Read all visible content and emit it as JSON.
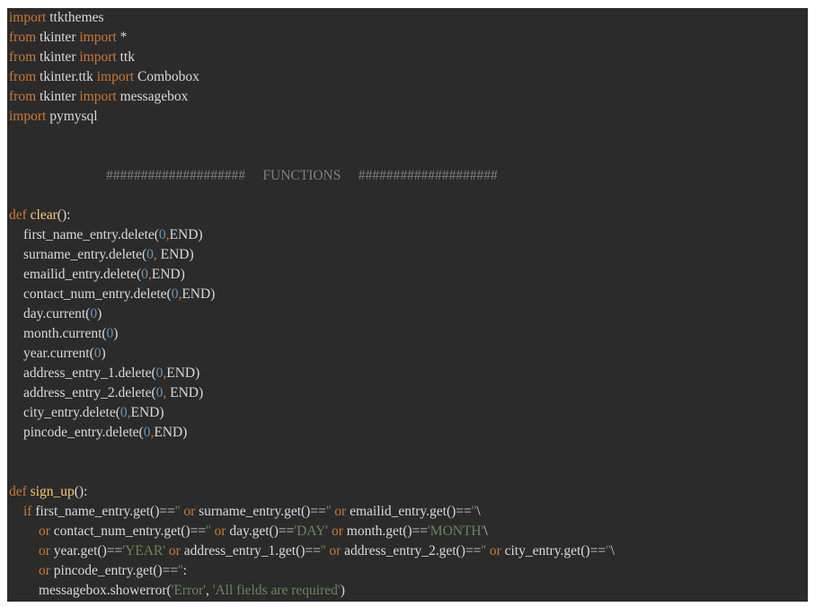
{
  "colors": {
    "background": "#2b2b2b",
    "keyword": "#cc7832",
    "function_name": "#ffc66d",
    "number": "#6897bb",
    "string": "#6a8759",
    "comment": "#808080",
    "text": "#d9d9d9"
  },
  "code_lines": [
    {
      "indent": 0,
      "tokens": [
        {
          "t": "kw",
          "v": "import"
        },
        {
          "t": "tx",
          "v": " ttkthemes"
        }
      ]
    },
    {
      "indent": 0,
      "tokens": [
        {
          "t": "kw",
          "v": "from"
        },
        {
          "t": "tx",
          "v": " tkinter "
        },
        {
          "t": "kw",
          "v": "import"
        },
        {
          "t": "tx",
          "v": " *"
        }
      ]
    },
    {
      "indent": 0,
      "tokens": [
        {
          "t": "kw",
          "v": "from"
        },
        {
          "t": "tx",
          "v": " tkinter "
        },
        {
          "t": "kw",
          "v": "import"
        },
        {
          "t": "tx",
          "v": " ttk"
        }
      ]
    },
    {
      "indent": 0,
      "tokens": [
        {
          "t": "kw",
          "v": "from"
        },
        {
          "t": "tx",
          "v": " tkinter.ttk "
        },
        {
          "t": "kw",
          "v": "import"
        },
        {
          "t": "tx",
          "v": " Combobox"
        }
      ]
    },
    {
      "indent": 0,
      "tokens": [
        {
          "t": "kw",
          "v": "from"
        },
        {
          "t": "tx",
          "v": " tkinter "
        },
        {
          "t": "kw",
          "v": "import"
        },
        {
          "t": "tx",
          "v": " messagebox"
        }
      ]
    },
    {
      "indent": 0,
      "tokens": [
        {
          "t": "kw",
          "v": "import"
        },
        {
          "t": "tx",
          "v": " pymysql"
        }
      ]
    },
    {
      "indent": 0,
      "tokens": []
    },
    {
      "indent": 0,
      "tokens": []
    },
    {
      "indent": 108,
      "tokens": [
        {
          "t": "cm",
          "v": "####################     FUNCTIONS     ####################"
        }
      ]
    },
    {
      "indent": 0,
      "tokens": []
    },
    {
      "indent": 0,
      "tokens": [
        {
          "t": "kw",
          "v": "def"
        },
        {
          "t": "tx",
          "v": " "
        },
        {
          "t": "fn",
          "v": "clear"
        },
        {
          "t": "tx",
          "v": "():"
        }
      ]
    },
    {
      "indent": 16,
      "tokens": [
        {
          "t": "tx",
          "v": "first_name_entry.delete("
        },
        {
          "t": "num",
          "v": "0"
        },
        {
          "t": "kw",
          "v": ","
        },
        {
          "t": "tx",
          "v": "END)"
        }
      ]
    },
    {
      "indent": 16,
      "tokens": [
        {
          "t": "tx",
          "v": "surname_entry.delete("
        },
        {
          "t": "num",
          "v": "0"
        },
        {
          "t": "kw",
          "v": ","
        },
        {
          "t": "tx",
          "v": " END)"
        }
      ]
    },
    {
      "indent": 16,
      "tokens": [
        {
          "t": "tx",
          "v": "emailid_entry.delete("
        },
        {
          "t": "num",
          "v": "0"
        },
        {
          "t": "kw",
          "v": ","
        },
        {
          "t": "tx",
          "v": "END)"
        }
      ]
    },
    {
      "indent": 16,
      "tokens": [
        {
          "t": "tx",
          "v": "contact_num_entry.delete("
        },
        {
          "t": "num",
          "v": "0"
        },
        {
          "t": "kw",
          "v": ","
        },
        {
          "t": "tx",
          "v": "END)"
        }
      ]
    },
    {
      "indent": 16,
      "tokens": [
        {
          "t": "tx",
          "v": "day.current("
        },
        {
          "t": "num",
          "v": "0"
        },
        {
          "t": "tx",
          "v": ")"
        }
      ]
    },
    {
      "indent": 16,
      "tokens": [
        {
          "t": "tx",
          "v": "month.current("
        },
        {
          "t": "num",
          "v": "0"
        },
        {
          "t": "tx",
          "v": ")"
        }
      ]
    },
    {
      "indent": 16,
      "tokens": [
        {
          "t": "tx",
          "v": "year.current("
        },
        {
          "t": "num",
          "v": "0"
        },
        {
          "t": "tx",
          "v": ")"
        }
      ]
    },
    {
      "indent": 16,
      "tokens": [
        {
          "t": "tx",
          "v": "address_entry_1.delete("
        },
        {
          "t": "num",
          "v": "0"
        },
        {
          "t": "kw",
          "v": ","
        },
        {
          "t": "tx",
          "v": "END)"
        }
      ]
    },
    {
      "indent": 16,
      "tokens": [
        {
          "t": "tx",
          "v": "address_entry_2.delete("
        },
        {
          "t": "num",
          "v": "0"
        },
        {
          "t": "kw",
          "v": ","
        },
        {
          "t": "tx",
          "v": " END)"
        }
      ]
    },
    {
      "indent": 16,
      "tokens": [
        {
          "t": "tx",
          "v": "city_entry.delete("
        },
        {
          "t": "num",
          "v": "0"
        },
        {
          "t": "kw",
          "v": ","
        },
        {
          "t": "tx",
          "v": "END)"
        }
      ]
    },
    {
      "indent": 16,
      "tokens": [
        {
          "t": "tx",
          "v": "pincode_entry.delete("
        },
        {
          "t": "num",
          "v": "0"
        },
        {
          "t": "kw",
          "v": ","
        },
        {
          "t": "tx",
          "v": "END)"
        }
      ]
    },
    {
      "indent": 0,
      "tokens": []
    },
    {
      "indent": 0,
      "tokens": []
    },
    {
      "indent": 0,
      "tokens": [
        {
          "t": "kw",
          "v": "def"
        },
        {
          "t": "tx",
          "v": " "
        },
        {
          "t": "fn",
          "v": "sign_up"
        },
        {
          "t": "tx",
          "v": "():"
        }
      ]
    },
    {
      "indent": 16,
      "tokens": [
        {
          "t": "kw",
          "v": "if"
        },
        {
          "t": "tx",
          "v": " first_name_entry.get()=="
        },
        {
          "t": "str",
          "v": "''"
        },
        {
          "t": "tx",
          "v": " "
        },
        {
          "t": "kw",
          "v": "or"
        },
        {
          "t": "tx",
          "v": " surname_entry.get()=="
        },
        {
          "t": "str",
          "v": "''"
        },
        {
          "t": "tx",
          "v": " "
        },
        {
          "t": "kw",
          "v": "or"
        },
        {
          "t": "tx",
          "v": " emailid_entry.get()=="
        },
        {
          "t": "str",
          "v": "''"
        },
        {
          "t": "tx",
          "v": "\\"
        }
      ]
    },
    {
      "indent": 33,
      "tokens": [
        {
          "t": "kw",
          "v": "or"
        },
        {
          "t": "tx",
          "v": " contact_num_entry.get()=="
        },
        {
          "t": "str",
          "v": "''"
        },
        {
          "t": "tx",
          "v": " "
        },
        {
          "t": "kw",
          "v": "or"
        },
        {
          "t": "tx",
          "v": " day.get()=="
        },
        {
          "t": "str",
          "v": "'DAY'"
        },
        {
          "t": "tx",
          "v": " "
        },
        {
          "t": "kw",
          "v": "or"
        },
        {
          "t": "tx",
          "v": " month.get()=="
        },
        {
          "t": "str",
          "v": "'MONTH'"
        },
        {
          "t": "tx",
          "v": "\\"
        }
      ]
    },
    {
      "indent": 33,
      "tokens": [
        {
          "t": "kw",
          "v": "or"
        },
        {
          "t": "tx",
          "v": " year.get()=="
        },
        {
          "t": "str",
          "v": "'YEAR'"
        },
        {
          "t": "tx",
          "v": " "
        },
        {
          "t": "kw",
          "v": "or"
        },
        {
          "t": "tx",
          "v": " address_entry_1.get()=="
        },
        {
          "t": "str",
          "v": "''"
        },
        {
          "t": "tx",
          "v": " "
        },
        {
          "t": "kw",
          "v": "or"
        },
        {
          "t": "tx",
          "v": " address_entry_2.get()=="
        },
        {
          "t": "str",
          "v": "''"
        },
        {
          "t": "tx",
          "v": " "
        },
        {
          "t": "kw",
          "v": "or"
        },
        {
          "t": "tx",
          "v": " city_entry.get()=="
        },
        {
          "t": "str",
          "v": "''"
        },
        {
          "t": "tx",
          "v": "\\"
        }
      ]
    },
    {
      "indent": 33,
      "tokens": [
        {
          "t": "kw",
          "v": "or"
        },
        {
          "t": "tx",
          "v": " pincode_entry.get()=="
        },
        {
          "t": "str",
          "v": "''"
        },
        {
          "t": "tx",
          "v": ":"
        }
      ]
    },
    {
      "indent": 33,
      "tokens": [
        {
          "t": "tx",
          "v": "messagebox.showerror("
        },
        {
          "t": "str",
          "v": "'Error'"
        },
        {
          "t": "tx",
          "v": ", "
        },
        {
          "t": "str",
          "v": "'All fields are required'"
        },
        {
          "t": "tx",
          "v": ")"
        }
      ]
    }
  ]
}
